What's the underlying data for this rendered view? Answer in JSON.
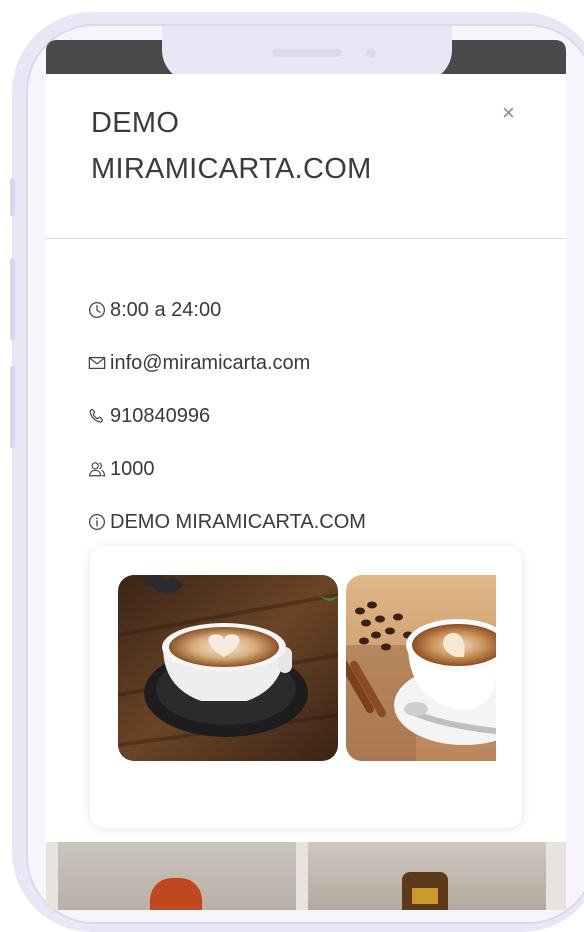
{
  "modal": {
    "title_line1": "DEMO",
    "title_line2": "MIRAMICARTA.COM",
    "close_label": "×"
  },
  "info": [
    {
      "icon": "clock-icon",
      "text": "8:00 a 24:00"
    },
    {
      "icon": "mail-icon",
      "text": "info@miramicarta.com"
    },
    {
      "icon": "phone-icon",
      "text": "910840996"
    },
    {
      "icon": "users-icon",
      "text": "1000"
    },
    {
      "icon": "info-icon",
      "text": "DEMO MIRAMICARTA.COM"
    }
  ],
  "gallery": [
    {
      "subject": "latte art coffee cup on wooden table"
    },
    {
      "subject": "cappuccino with coffee beans and cinnamon"
    }
  ],
  "colors": {
    "frame": "#e9e7f6",
    "text": "#3a3a3a",
    "divider": "#dcdcdc"
  }
}
